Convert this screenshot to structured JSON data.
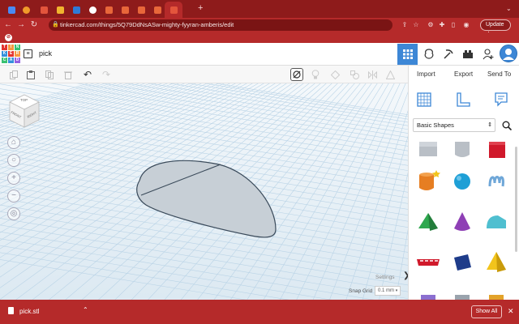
{
  "browser": {
    "tabs": [
      {
        "icon": "docs-icon",
        "color": "#4a8af4"
      },
      {
        "icon": "orange-app-icon",
        "color": "#f09a2a"
      },
      {
        "icon": "grid-app-icon",
        "color": "#e3553c"
      },
      {
        "icon": "grid-app-icon",
        "color": "#f1b42f"
      },
      {
        "icon": "blue-square-icon",
        "color": "#2f7bd6"
      },
      {
        "icon": "person-icon",
        "color": "#ffffff"
      },
      {
        "icon": "arrow-app-icon",
        "color": "#e8673a"
      },
      {
        "icon": "arrow-app-icon",
        "color": "#e8673a"
      },
      {
        "icon": "arrow-app-icon",
        "color": "#e8673a"
      },
      {
        "icon": "arrow-app-icon",
        "color": "#e8673a"
      },
      {
        "icon": "tinkercad-icon",
        "color": "#e3553c",
        "active": true
      }
    ],
    "url": "tinkercad.com/things/5Q79DdNsASw-mighty-fyyran-amberis/edit",
    "update_label": "Update",
    "accent": "#b52a2a"
  },
  "app": {
    "logo_letters": [
      "TIN",
      "KER",
      "CAD"
    ],
    "logo_cells": [
      "T",
      "I",
      "N",
      "K",
      "E",
      "R",
      "C",
      "A",
      "D"
    ],
    "logo_colors": [
      "#e3342f",
      "#f6993f",
      "#38c172",
      "#3490dc",
      "#e3342f",
      "#f6993f",
      "#38c172",
      "#3490dc",
      "#9561e2"
    ],
    "design_title": "pick"
  },
  "workplane": {
    "view_cube": {
      "top": "TOP",
      "front": "FRONT",
      "right": "RIGHT"
    },
    "settings_label": "Settings",
    "snap_grid_label": "Snap Grid",
    "snap_grid_value": "0.1 mm"
  },
  "panel": {
    "tabs": [
      "Import",
      "Export",
      "Send To"
    ],
    "shape_category": "Basic Shapes",
    "shapes": [
      {
        "name": "box-shape-gray",
        "color": "#b9bfc6"
      },
      {
        "name": "cylinder-shape-gray",
        "color": "#b9bfc6"
      },
      {
        "name": "box-shape",
        "color": "#d0192b"
      },
      {
        "name": "cylinder-shape",
        "color": "#e67e22"
      },
      {
        "name": "sphere-shape",
        "color": "#1e9fd6"
      },
      {
        "name": "scribble-shape",
        "color": "#6fa7d8"
      },
      {
        "name": "pyramid-shape",
        "color": "#2fa84f"
      },
      {
        "name": "cone-shape",
        "color": "#8e3fb5"
      },
      {
        "name": "roof-shape",
        "color": "#4fbfd0"
      },
      {
        "name": "text-shape",
        "color": "#d0192b"
      },
      {
        "name": "box-shape-blue",
        "color": "#1e3c8a"
      },
      {
        "name": "pyramid-shape-yellow",
        "color": "#f2c41c"
      }
    ]
  },
  "download": {
    "filename": "pick.stl",
    "show_all_label": "Show All"
  }
}
